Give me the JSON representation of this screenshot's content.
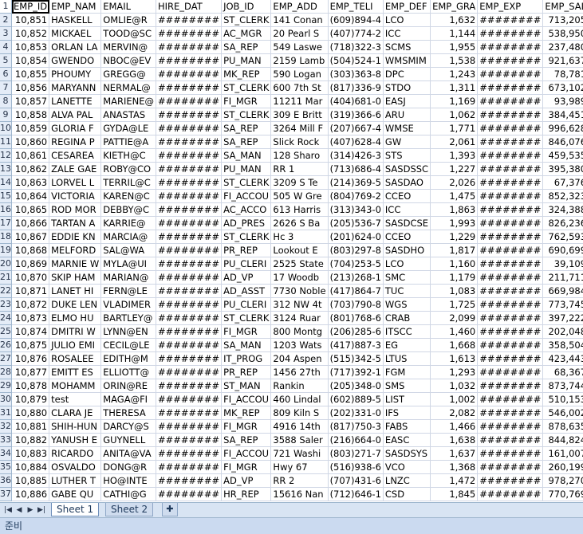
{
  "columns": [
    "EMP_ID",
    "EMP_NAM",
    "EMAIL",
    "HIRE_DAT",
    "JOB_ID",
    "EMP_ADD",
    "EMP_TELI",
    "EMP_DEF",
    "EMP_GRA",
    "EMP_EXP",
    "EMP_SAL"
  ],
  "rows": [
    [
      "2",
      "10,851",
      "HASKELL",
      "OMLIE@R",
      "########",
      "ST_CLERK",
      "141 Conan",
      "(609)894-4",
      "LCO",
      "1,632",
      "########",
      "713,205"
    ],
    [
      "3",
      "10,852",
      "MICKAEL",
      "TOOD@SC",
      "########",
      "AC_MGR",
      "20 Pearl S",
      "(407)774-2",
      "ICC",
      "1,144",
      "########",
      "538,950"
    ],
    [
      "4",
      "10,853",
      "ORLAN LA",
      "MERVIN@",
      "########",
      "SA_REP",
      "549 Laswe",
      "(718)322-3",
      "SCMS",
      "1,955",
      "########",
      "237,480"
    ],
    [
      "5",
      "10,854",
      "GWENDO",
      "NBOC@EV",
      "########",
      "PU_MAN",
      "2159 Lamb",
      "(504)524-1",
      "WMSMIM",
      "1,538",
      "########",
      "921,637"
    ],
    [
      "6",
      "10,855",
      "PHOUMY",
      "GREGG@",
      "########",
      "MK_REP",
      "590 Logan",
      "(303)363-8",
      "DPC",
      "1,243",
      "########",
      "78,781"
    ],
    [
      "7",
      "10,856",
      "MARYANN",
      "NERMAL@",
      "########",
      "ST_CLERK",
      "600 7th St",
      "(817)336-9",
      "STDO",
      "1,311",
      "########",
      "673,102"
    ],
    [
      "8",
      "10,857",
      "LANETTE",
      "MARIENE@",
      "########",
      "FI_MGR",
      "11211 Mar",
      "(404)681-0",
      "EASJ",
      "1,169",
      "########",
      "93,989"
    ],
    [
      "9",
      "10,858",
      "ALVA PAL",
      "ANASTAS",
      "########",
      "ST_CLERK",
      "309 E Britt",
      "(319)366-6",
      "ARU",
      "1,062",
      "########",
      "384,451"
    ],
    [
      "10",
      "10,859",
      "GLORIA F",
      "GYDA@LE",
      "########",
      "SA_REP",
      "3264 Mill F",
      "(207)667-4",
      "WMSE",
      "1,771",
      "########",
      "996,628"
    ],
    [
      "11",
      "10,860",
      "REGINA P",
      "PATTIE@A",
      "########",
      "SA_REP",
      "Slick Rock",
      "(407)628-4",
      "GW",
      "2,061",
      "########",
      "846,076"
    ],
    [
      "12",
      "10,861",
      "CESAREA",
      "KIETH@C",
      "########",
      "SA_MAN",
      "128 Sharo",
      "(314)426-3",
      "STS",
      "1,393",
      "########",
      "459,535"
    ],
    [
      "13",
      "10,862",
      "ZALE GAE",
      "ROBY@CO",
      "########",
      "PU_MAN",
      "RR 1",
      "(713)686-4",
      "SASDSSC",
      "1,227",
      "########",
      "395,380"
    ],
    [
      "14",
      "10,863",
      "LORVEL L",
      "TERRIL@C",
      "########",
      "ST_CLERK",
      "3209 S Te",
      "(214)369-5",
      "SASDAO",
      "2,026",
      "########",
      "67,376"
    ],
    [
      "15",
      "10,864",
      "VICTORIA",
      "KAREN@C",
      "########",
      "FI_ACCOU",
      "505 W Gre",
      "(804)769-2",
      "CCEO",
      "1,475",
      "########",
      "852,323"
    ],
    [
      "16",
      "10,865",
      "ROD MOR",
      "DEBBY@C",
      "########",
      "AC_ACCO",
      "613 Harris",
      "(313)343-0",
      "ICC",
      "1,863",
      "########",
      "324,388"
    ],
    [
      "17",
      "10,866",
      "TARTAN A",
      "KARRIE@",
      "########",
      "AD_PRES",
      "2626 S Ba",
      "(205)536-7",
      "SASDCSE",
      "1,993",
      "########",
      "826,236"
    ],
    [
      "18",
      "10,867",
      "EDDIE KN",
      "MARCIA@",
      "########",
      "ST_CLERK",
      "Hc 3",
      "(201)624-0",
      "CCEO",
      "1,229",
      "########",
      "762,593"
    ],
    [
      "19",
      "10,868",
      "MELFORD",
      "SAL@WA",
      "########",
      "PR_REP",
      "Lookout E",
      "(803)297-8",
      "SASDHO",
      "1,817",
      "########",
      "690,699"
    ],
    [
      "20",
      "10,869",
      "MARNIE W",
      "MYLA@UI",
      "########",
      "PU_CLERI",
      "2525 State",
      "(704)253-5",
      "LCO",
      "1,160",
      "########",
      "39,109"
    ],
    [
      "21",
      "10,870",
      "SKIP HAM",
      "MARIAN@",
      "########",
      "AD_VP",
      "17 Woodb",
      "(213)268-1",
      "SMC",
      "1,179",
      "########",
      "211,711"
    ],
    [
      "22",
      "10,871",
      "LANET HI",
      "FERN@LE",
      "########",
      "AD_ASST",
      "7730 Noble",
      "(417)864-7",
      "TUC",
      "1,083",
      "########",
      "669,984"
    ],
    [
      "23",
      "10,872",
      "DUKE LEN",
      "VLADIMER",
      "########",
      "PU_CLERI",
      "312 NW 4t",
      "(703)790-8",
      "WGS",
      "1,725",
      "########",
      "773,745"
    ],
    [
      "24",
      "10,873",
      "ELMO HU",
      "BARTLEY@",
      "########",
      "ST_CLERK",
      "3124 Ruar",
      "(801)768-6",
      "CRAB",
      "2,099",
      "########",
      "397,222"
    ],
    [
      "25",
      "10,874",
      "DMITRI W",
      "LYNN@EN",
      "########",
      "FI_MGR",
      "800 Montg",
      "(206)285-6",
      "ITSCC",
      "1,460",
      "########",
      "202,048"
    ],
    [
      "26",
      "10,875",
      "JULIO EMI",
      "CECIL@LE",
      "########",
      "SA_MAN",
      "1203 Wats",
      "(417)887-3",
      "EG",
      "1,668",
      "########",
      "358,504"
    ],
    [
      "27",
      "10,876",
      "ROSALEE",
      "EDITH@M",
      "########",
      "IT_PROG",
      "204 Aspen",
      "(515)342-5",
      "LTUS",
      "1,613",
      "########",
      "423,443"
    ],
    [
      "28",
      "10,877",
      "EMITT ES",
      "ELLIOTT@",
      "########",
      "PR_REP",
      "1456 27th",
      "(717)392-1",
      "FGM",
      "1,293",
      "########",
      "68,367"
    ],
    [
      "29",
      "10,878",
      "MOHAMM",
      "ORIN@RE",
      "########",
      "ST_MAN",
      "Rankin",
      "(205)348-0",
      "SMS",
      "1,032",
      "########",
      "873,744"
    ],
    [
      "30",
      "10,879",
      "test",
      "MAGA@FI",
      "########",
      "FI_ACCOU",
      "460 Lindal",
      "(602)889-5",
      "LIST",
      "1,002",
      "########",
      "510,153"
    ],
    [
      "31",
      "10,880",
      "CLARA JE",
      "THERESA",
      "########",
      "MK_REP",
      "809 Kiln S",
      "(202)331-0",
      "IFS",
      "2,082",
      "########",
      "546,002"
    ],
    [
      "32",
      "10,881",
      "SHIH-HUN",
      "DARCY@S",
      "########",
      "FI_MGR",
      "4916 14th",
      "(817)750-3",
      "FABS",
      "1,466",
      "########",
      "878,635"
    ],
    [
      "33",
      "10,882",
      "YANUSH E",
      "GUYNELL",
      "########",
      "SA_REP",
      "3588 Saler",
      "(216)664-0",
      "EASC",
      "1,638",
      "########",
      "844,824"
    ],
    [
      "34",
      "10,883",
      "RICARDO",
      "ANITA@VA",
      "########",
      "FI_ACCOU",
      "721 Washi",
      "(803)271-7",
      "SASDSYS",
      "1,637",
      "########",
      "161,007"
    ],
    [
      "35",
      "10,884",
      "OSVALDO",
      "DONG@R",
      "########",
      "FI_MGR",
      "Hwy 67",
      "(516)938-6",
      "VCO",
      "1,368",
      "########",
      "260,199"
    ],
    [
      "36",
      "10,885",
      "LUTHER T",
      "HO@INTE",
      "########",
      "AD_VP",
      "RR 2",
      "(707)431-6",
      "LNZC",
      "1,472",
      "########",
      "978,270"
    ],
    [
      "37",
      "10,886",
      "GABE QU",
      "CATHI@G",
      "########",
      "HR_REP",
      "15616 Nan",
      "(712)646-1",
      "CSD",
      "1,845",
      "########",
      "770,769"
    ]
  ],
  "tabs": [
    "Sheet 1",
    "Sheet 2"
  ],
  "status_text": "준비",
  "nav_buttons": [
    "|◀",
    "◀",
    "▶",
    "▶|"
  ]
}
